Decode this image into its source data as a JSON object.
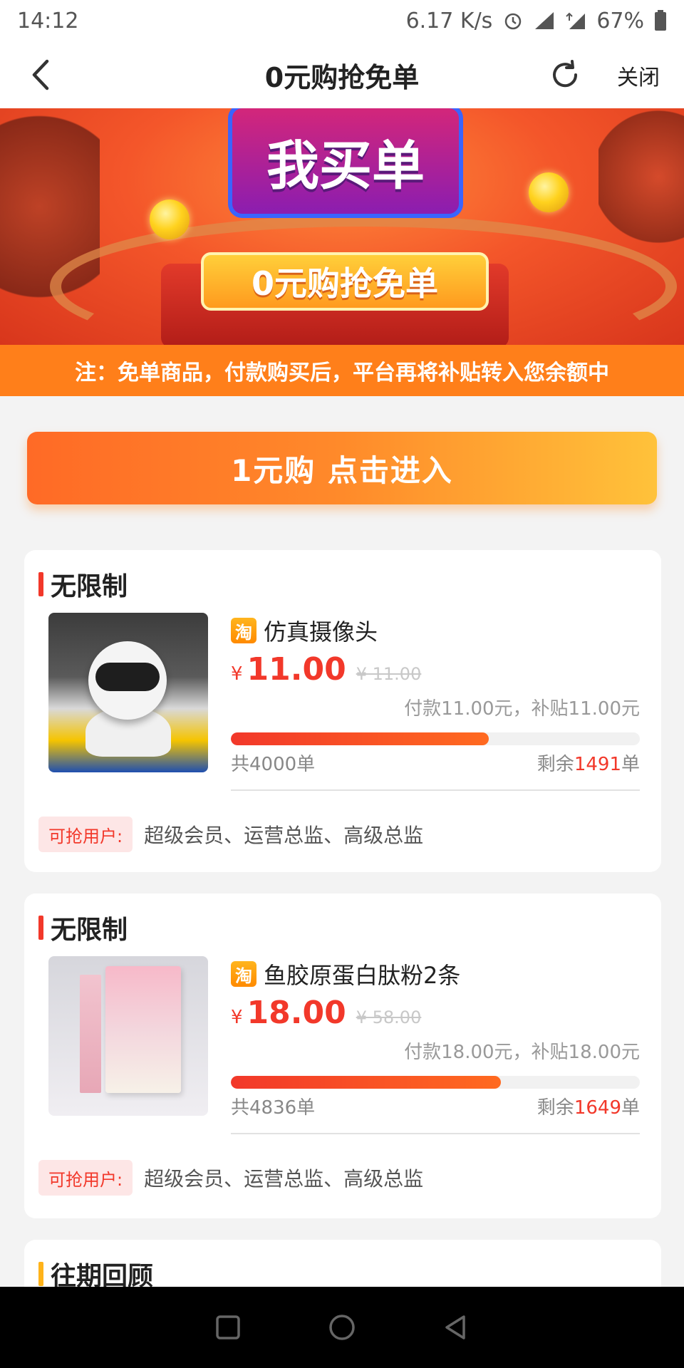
{
  "status_bar": {
    "time": "14:12",
    "speed": "6.17 K/s",
    "battery": "67%"
  },
  "header": {
    "title": "0元购抢免单",
    "close_label": "关闭"
  },
  "banner": {
    "headline": "我买单",
    "pill_text": "0元购抢免单",
    "note": "注：免单商品，付款购买后，平台再将补贴转入您余额中"
  },
  "one_yuan": {
    "label": "1元购 点击进入"
  },
  "products": [
    {
      "section_label": "无限制",
      "platform_badge": "淘",
      "title": "仿真摄像头",
      "currency": "¥",
      "price": "11.00",
      "original_price": "¥ 11.00",
      "pay_line": "付款11.00元，补贴11.00元",
      "progress_percent": 63,
      "total_label": "共4000单",
      "remain_prefix": "剩余",
      "remain_count": "1491",
      "remain_suffix": "单",
      "users_tag": "可抢用户:",
      "users_list": "超级会员、运营总监、高级总监"
    },
    {
      "section_label": "无限制",
      "platform_badge": "淘",
      "title": "鱼胶原蛋白肽粉2条",
      "currency": "¥",
      "price": "18.00",
      "original_price": "¥ 58.00",
      "pay_line": "付款18.00元，补贴18.00元",
      "progress_percent": 66,
      "total_label": "共4836单",
      "remain_prefix": "剩余",
      "remain_count": "1649",
      "remain_suffix": "单",
      "users_tag": "可抢用户:",
      "users_list": "超级会员、运营总监、高级总监"
    }
  ],
  "history": {
    "label": "往期回顾"
  },
  "colors": {
    "accent": "#f2382a",
    "orange": "#ff7f1a",
    "badge": "#ff9a00"
  }
}
